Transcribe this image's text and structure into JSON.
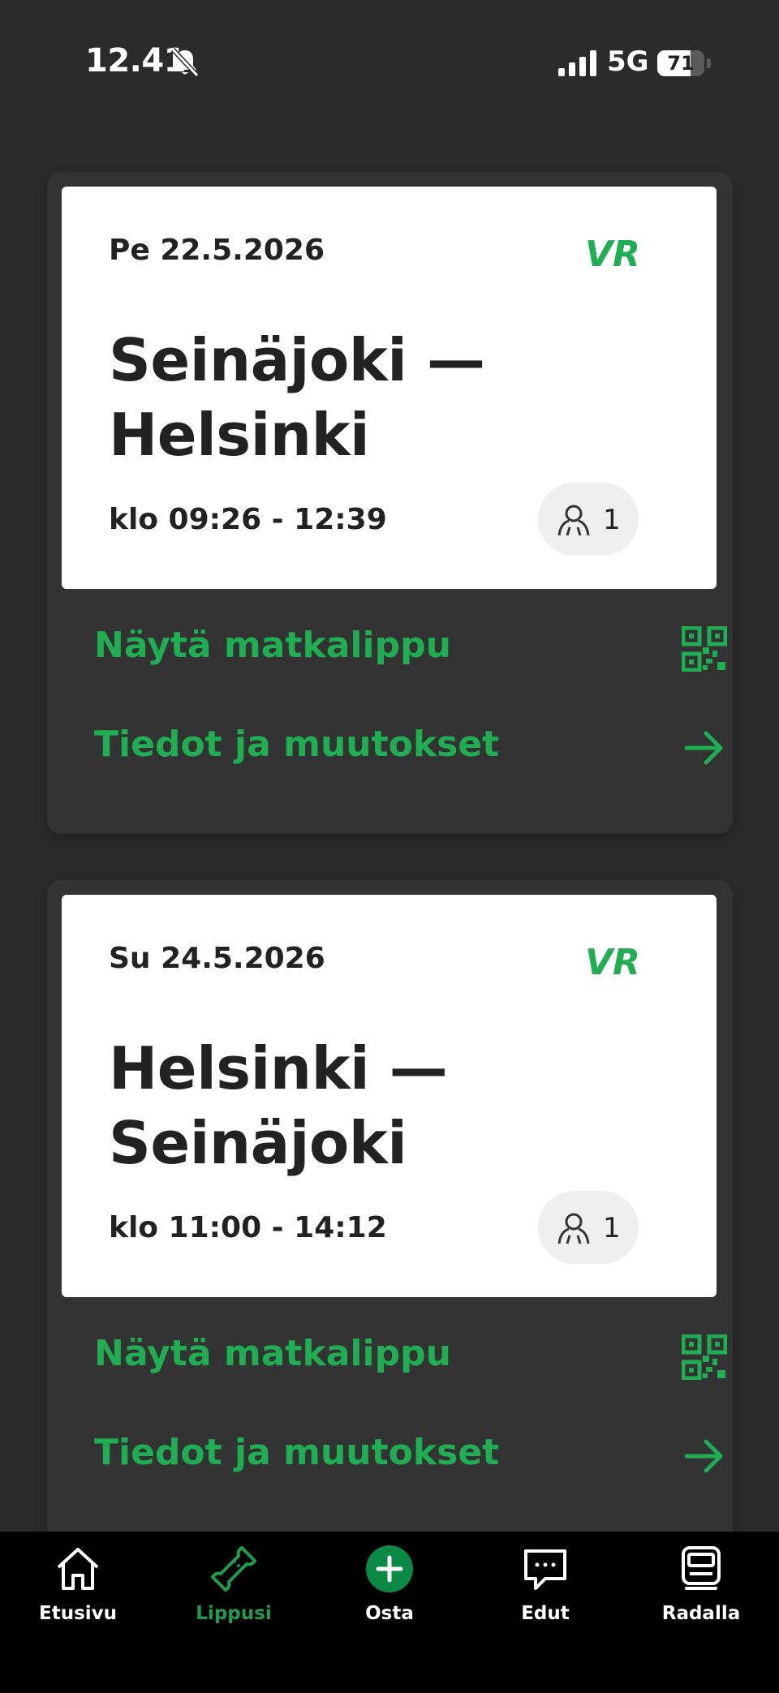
{
  "status_bar": {
    "time": "12.41",
    "network": "5G",
    "battery": "71",
    "battery_fraction": 0.71
  },
  "tickets": [
    {
      "date": "Pe 22.5.2026",
      "logo": "VR",
      "route_line1": "Seinäjoki —",
      "route_line2": "Helsinki",
      "times": "klo 09:26 - 12:39",
      "passengers": "1",
      "show_ticket_label": "Näytä matkalippu",
      "details_label": "Tiedot ja muutokset"
    },
    {
      "date": "Su 24.5.2026",
      "logo": "VR",
      "route_line1": "Helsinki —",
      "route_line2": "Seinäjoki",
      "times": "klo 11:00 - 14:12",
      "passengers": "1",
      "show_ticket_label": "Näytä matkalippu",
      "details_label": "Tiedot ja muutokset"
    }
  ],
  "tab_bar": [
    {
      "label": "Etusivu",
      "icon": "home-icon"
    },
    {
      "label": "Lippusi",
      "icon": "ticket-icon",
      "active": true
    },
    {
      "label": "Osta",
      "icon": "plus-circle-icon"
    },
    {
      "label": "Edut",
      "icon": "chat-bubble-icon"
    },
    {
      "label": "Radalla",
      "icon": "train-icon"
    }
  ],
  "colors": {
    "accent_green": "#1fae52",
    "background": "#2b2b2b",
    "card": "#333333"
  }
}
